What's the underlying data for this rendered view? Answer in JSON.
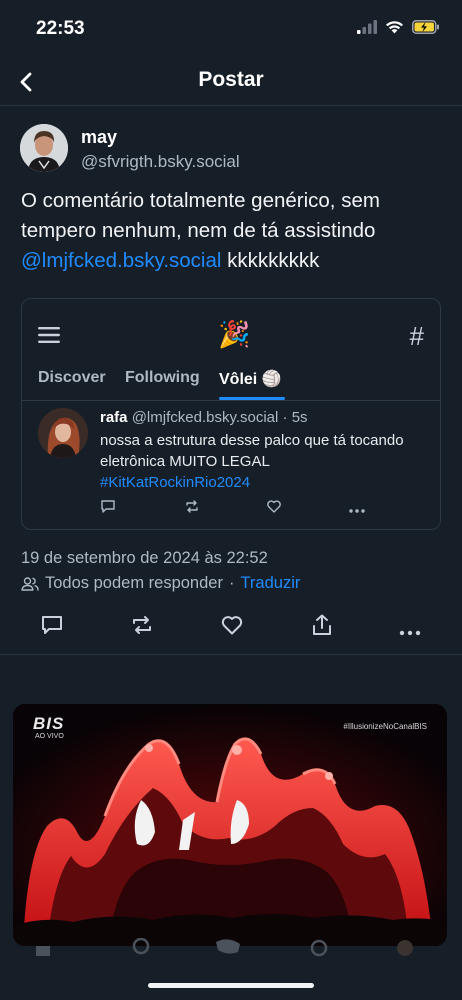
{
  "status_bar": {
    "time": "22:53",
    "icons": [
      "cellular-signal-icon",
      "wifi-icon",
      "battery-charging-icon"
    ]
  },
  "nav": {
    "back_icon": "chevron-left-icon",
    "title": "Postar"
  },
  "post": {
    "author_name": "may",
    "author_handle": "@sfvrigth.bsky.social",
    "text_before": "O comentário totalmente genérico, sem tempero nenhum, nem de tá assistindo ",
    "mention": "@lmjfcked.bsky.social",
    "text_after": " kkkkkkkkk",
    "timestamp": "19 de setembro de 2024 às 22:52",
    "reply_setting": "Todos podem responder",
    "separator": "·",
    "translate_label": "Traduzir"
  },
  "embed": {
    "menu_icon": "hamburger-menu-icon",
    "logo_emoji": "🎉",
    "hash_icon": "#",
    "tabs": [
      {
        "label": "Discover",
        "active": false
      },
      {
        "label": "Following",
        "active": false
      },
      {
        "label": "Vôlei 🏐",
        "active": true
      }
    ],
    "inner_post": {
      "name": "rafa",
      "handle": "@lmjfcked.bsky.social",
      "age": "· 5s",
      "text": "nossa a estrutura desse palco que tá tocando eletrônica MUITO LEGAL",
      "hashtag": "#KitKatRockinRio2024",
      "actions": [
        "reply-icon",
        "repost-icon",
        "like-icon",
        "more-icon"
      ]
    }
  },
  "post_actions": [
    "reply-icon",
    "repost-icon",
    "like-icon",
    "share-icon",
    "more-icon"
  ],
  "video": {
    "channel_logo": "BIS",
    "channel_sub": "AO VIVO",
    "hashtag_overlay": "#IllusionizeNoCanalBIS"
  },
  "colors": {
    "background": "#161e27",
    "accent": "#208bfe",
    "muted": "#aeb9c5",
    "stage_red": "#ff2a2a"
  }
}
